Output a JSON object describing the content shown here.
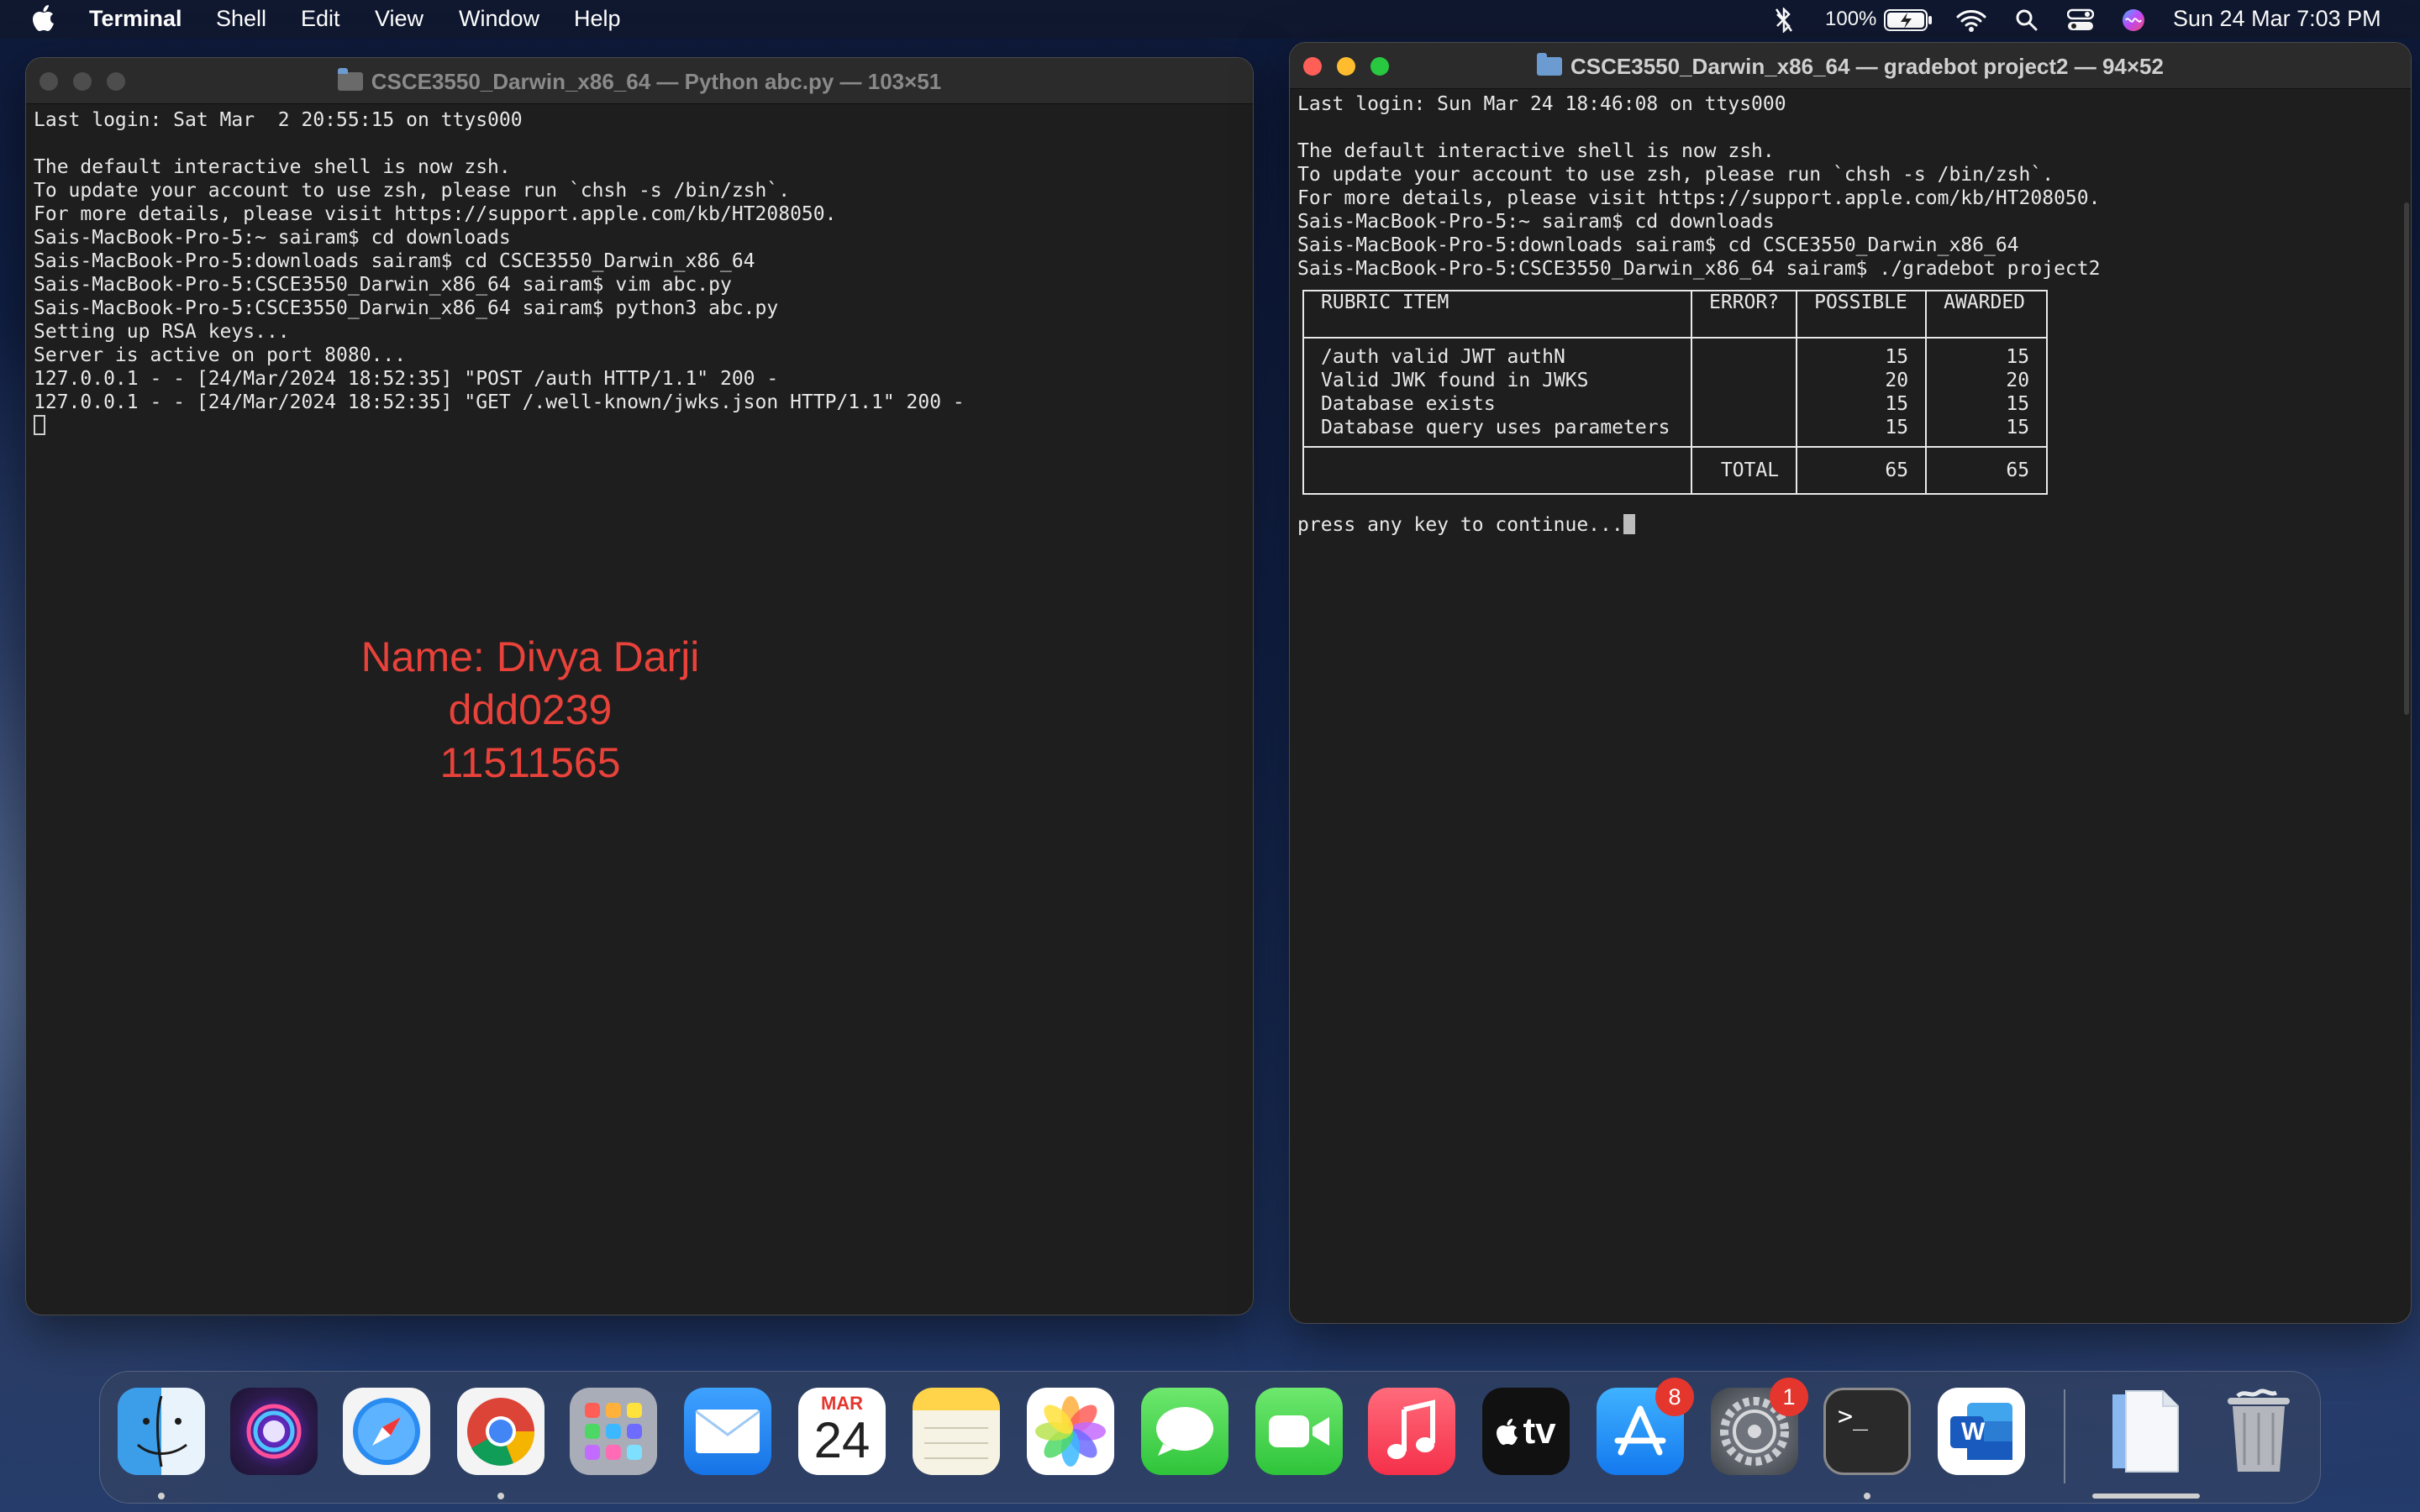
{
  "menubar": {
    "app_name": "Terminal",
    "items": [
      "Shell",
      "Edit",
      "View",
      "Window",
      "Help"
    ],
    "battery_percent": "100%",
    "datetime": "Sun 24 Mar  7:03 PM"
  },
  "left_window": {
    "title": "CSCE3550_Darwin_x86_64 — Python abc.py — 103×51",
    "lines": [
      "Last login: Sat Mar  2 20:55:15 on ttys000",
      "",
      "The default interactive shell is now zsh.",
      "To update your account to use zsh, please run `chsh -s /bin/zsh`.",
      "For more details, please visit https://support.apple.com/kb/HT208050.",
      "Sais-MacBook-Pro-5:~ sairam$ cd downloads",
      "Sais-MacBook-Pro-5:downloads sairam$ cd CSCE3550_Darwin_x86_64",
      "Sais-MacBook-Pro-5:CSCE3550_Darwin_x86_64 sairam$ vim abc.py",
      "Sais-MacBook-Pro-5:CSCE3550_Darwin_x86_64 sairam$ python3 abc.py",
      "Setting up RSA keys...",
      "Server is active on port 8080...",
      "127.0.0.1 - - [24/Mar/2024 18:52:35] \"POST /auth HTTP/1.1\" 200 -",
      "127.0.0.1 - - [24/Mar/2024 18:52:35] \"GET /.well-known/jwks.json HTTP/1.1\" 200 -"
    ],
    "overlay": {
      "name": "Name: Divya Darji",
      "id": "ddd0239",
      "number": "11511565"
    }
  },
  "right_window": {
    "title": "CSCE3550_Darwin_x86_64 — gradebot project2 — 94×52",
    "lines": [
      "Last login: Sun Mar 24 18:46:08 on ttys000",
      "",
      "The default interactive shell is now zsh.",
      "To update your account to use zsh, please run `chsh -s /bin/zsh`.",
      "For more details, please visit https://support.apple.com/kb/HT208050.",
      "Sais-MacBook-Pro-5:~ sairam$ cd downloads",
      "Sais-MacBook-Pro-5:downloads sairam$ cd CSCE3550_Darwin_x86_64",
      "Sais-MacBook-Pro-5:CSCE3550_Darwin_x86_64 sairam$ ./gradebot project2"
    ],
    "table": {
      "headers": [
        "RUBRIC ITEM",
        "ERROR?",
        "POSSIBLE",
        "AWARDED"
      ],
      "rows": [
        {
          "item": "/auth valid JWT authN",
          "error": "",
          "possible": "15",
          "awarded": "15"
        },
        {
          "item": "Valid JWK found in JWKS",
          "error": "",
          "possible": "20",
          "awarded": "20"
        },
        {
          "item": "Database exists",
          "error": "",
          "possible": "15",
          "awarded": "15"
        },
        {
          "item": "Database query uses parameters",
          "error": "",
          "possible": "15",
          "awarded": "15"
        }
      ],
      "total_label": "TOTAL",
      "total_possible": "65",
      "total_awarded": "65"
    },
    "prompt": "press any key to continue..."
  },
  "dock": {
    "apps": [
      {
        "name": "Finder",
        "icon": "finder-icon"
      },
      {
        "name": "Siri",
        "icon": "siri-icon"
      },
      {
        "name": "Safari",
        "icon": "safari-icon"
      },
      {
        "name": "Chrome",
        "icon": "chrome-icon"
      },
      {
        "name": "Launchpad",
        "icon": "launchpad-icon"
      },
      {
        "name": "Mail",
        "icon": "mail-icon"
      },
      {
        "name": "Calendar",
        "icon": "calendar-icon"
      },
      {
        "name": "Notes",
        "icon": "notes-icon"
      },
      {
        "name": "Photos",
        "icon": "photos-icon"
      },
      {
        "name": "Messages",
        "icon": "messages-icon"
      },
      {
        "name": "FaceTime",
        "icon": "facetime-icon"
      },
      {
        "name": "Music",
        "icon": "music-icon"
      },
      {
        "name": "TV",
        "icon": "tv-icon"
      },
      {
        "name": "App Store",
        "icon": "app-store-icon"
      },
      {
        "name": "System Preferences",
        "icon": "system-preferences-icon"
      },
      {
        "name": "Terminal",
        "icon": "terminal-icon"
      },
      {
        "name": "Word",
        "icon": "word-icon"
      },
      {
        "name": "Documents",
        "icon": "document-icon"
      },
      {
        "name": "Trash",
        "icon": "trash-icon"
      }
    ],
    "calendar_month": "MAR",
    "calendar_day": "24",
    "tv_label": "tv",
    "terminal_glyph": ">_",
    "word_glyph": "W",
    "app_store_badge": "8",
    "settings_badge": "1"
  },
  "colors": {
    "terminal_bg": "#1e1e1e",
    "terminal_text": "#e8e8e8",
    "overlay_text": "#e8423a",
    "traffic_red": "#ff5f57",
    "traffic_yellow": "#febc2e",
    "traffic_green": "#28c840"
  }
}
